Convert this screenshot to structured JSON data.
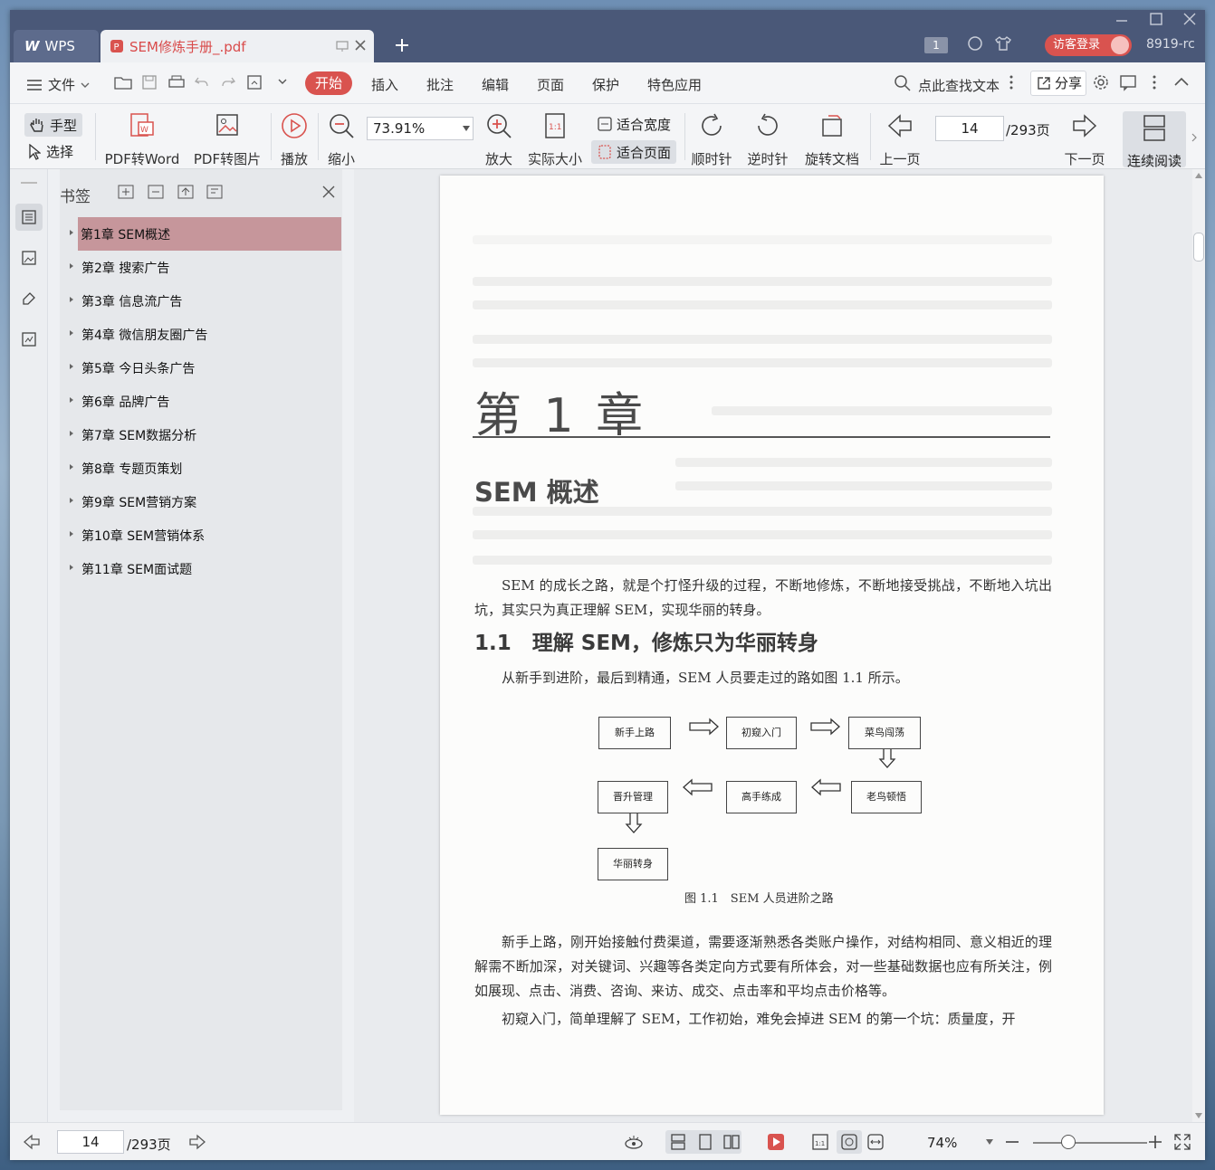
{
  "titlebar": {
    "app_tab": "WPS",
    "doc_tab": "SEM修炼手册_.pdf",
    "window_count": "1",
    "guest_login": "访客登录",
    "user_id": "8919-rc"
  },
  "menu": {
    "file": "文件",
    "items": [
      "开始",
      "插入",
      "批注",
      "编辑",
      "页面",
      "保护",
      "特色应用"
    ],
    "search": "点此查找文本",
    "share": "分享"
  },
  "ribbon": {
    "hand": "手型",
    "select": "选择",
    "pdf_to_word": "PDF转Word",
    "pdf_to_image": "PDF转图片",
    "play": "播放",
    "zoom_out": "缩小",
    "zoom_value": "73.91%",
    "zoom_in": "放大",
    "actual_size": "实际大小",
    "fit_width": "适合宽度",
    "fit_page": "适合页面",
    "clockwise": "顺时针",
    "counterclockwise": "逆时针",
    "rotate_doc": "旋转文档",
    "prev_page": "上一页",
    "page_current": "14",
    "page_total": "/293页",
    "next_page": "下一页",
    "continuous": "连续阅读"
  },
  "bookmarks": {
    "title": "书签",
    "items": [
      "第1章 SEM概述",
      "第2章 搜索广告",
      "第3章 信息流广告",
      "第4章 微信朋友圈广告",
      "第5章 今日头条广告",
      "第6章 品牌广告",
      "第7章 SEM数据分析",
      "第8章 专题页策划",
      "第9章 SEM营销方案",
      "第10章 SEM营销体系",
      "第11章 SEM面试题"
    ]
  },
  "page": {
    "chapter": "第 1 章",
    "chapter_title": "SEM 概述",
    "intro": "SEM 的成长之路，就是个打怪升级的过程，不断地修炼，不断地接受挑战，不断地入坑出坑，其实只为真正理解 SEM，实现华丽的转身。",
    "section": "1.1　理解 SEM，修炼只为华丽转身",
    "section_intro": "从新手到进阶，最后到精通，SEM 人员要走过的路如图 1.1 所示。",
    "flow": {
      "n1": "新手上路",
      "n2": "初窥入门",
      "n3": "菜鸟闯荡",
      "n4": "老鸟顿悟",
      "n5": "高手练成",
      "n6": "晋升管理",
      "n7": "华丽转身"
    },
    "caption": "图 1.1　SEM 人员进阶之路",
    "para1": "新手上路，刚开始接触付费渠道，需要逐渐熟悉各类账户操作，对结构相同、意义相近的理解需不断加深，对关键词、兴趣等各类定向方式要有所体会，对一些基础数据也应有所关注，例如展现、点击、消费、咨询、来访、成交、点击率和平均点击价格等。",
    "para2": "初窥入门，简单理解了 SEM，工作初始，难免会掉进 SEM 的第一个坑：质量度，开"
  },
  "status": {
    "page_current": "14",
    "page_total": "/293页",
    "zoom": "74%"
  },
  "colors": {
    "accent": "#d9534f",
    "titlebar": "#4a5878",
    "bookmark_active": "#c6969b"
  }
}
